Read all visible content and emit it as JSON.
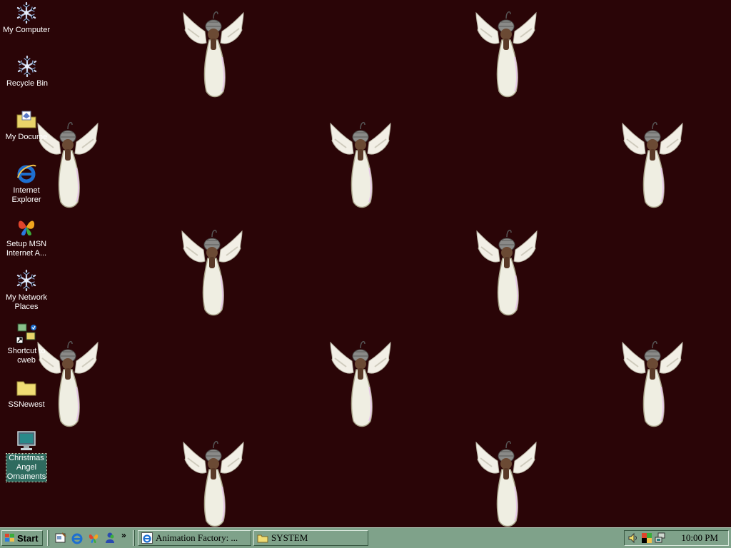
{
  "desktop": {
    "background_color": "#2a0507",
    "wallpaper": "Christmas angel ornament tiles",
    "icons": [
      {
        "label": "My Computer",
        "icon": "snowflake-icon"
      },
      {
        "label": "Recycle Bin",
        "icon": "snowflake-icon"
      },
      {
        "label": "My Docume",
        "icon": "folder-document-icon"
      },
      {
        "label": "Internet\nExplorer",
        "icon": "internet-explorer-icon"
      },
      {
        "label": "Setup MSN\nInternet A...",
        "icon": "msn-butterfly-icon"
      },
      {
        "label": "My Network\nPlaces",
        "icon": "snowflake-icon"
      },
      {
        "label": "Shortcut to\ncweb",
        "icon": "network-shortcut-icon"
      },
      {
        "label": "SSNewest",
        "icon": "folder-icon"
      },
      {
        "label": "Christmas\nAngel\nOrnaments",
        "icon": "monitor-icon",
        "selected": true
      }
    ]
  },
  "taskbar": {
    "start_label": "Start",
    "quick_launch": [
      "desktop-show-icon",
      "internet-explorer-icon",
      "msn-butterfly-icon",
      "messenger-icon"
    ],
    "overflow_label": "»",
    "tasks": [
      {
        "label": "Animation Factory: ...",
        "icon": "internet-explorer-icon"
      },
      {
        "label": "SYSTEM",
        "icon": "folder-icon"
      }
    ],
    "tray_icons": [
      "volume-icon",
      "color-scheme-icon",
      "network-icon"
    ],
    "clock": "10:00 PM",
    "color": "#7fa28a"
  }
}
